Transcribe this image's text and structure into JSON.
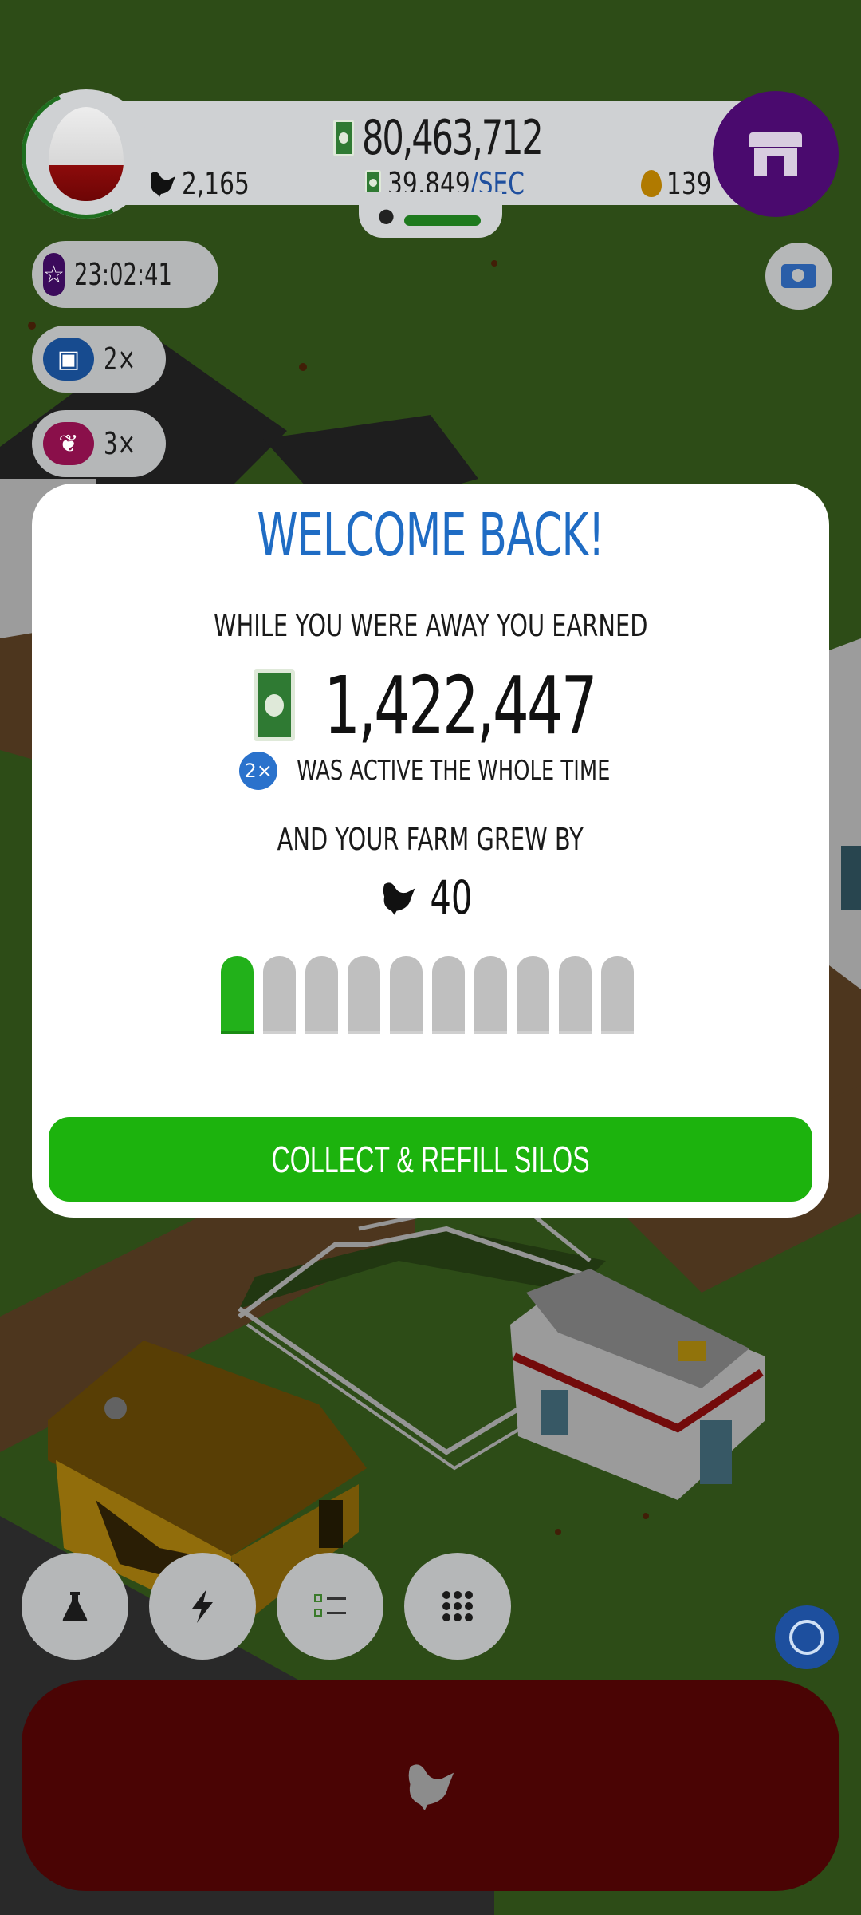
{
  "hud": {
    "cash": "80,463,712",
    "chickens": "2,165",
    "rate_value": "39,849",
    "rate_unit": "/SEC",
    "golden_eggs": "139",
    "egg_icon": "egg-icon",
    "shop_icon": "shop-icon"
  },
  "boosts": {
    "timer": "23:02:41",
    "video_multiplier": "2×",
    "boost_multiplier": "3×"
  },
  "modal": {
    "title": "WELCOME BACK!",
    "earned_label": "WHILE YOU WERE AWAY YOU EARNED",
    "earned_amount": "1,422,447",
    "boost_badge": "2×",
    "active_label": "WAS ACTIVE THE WHOLE TIME",
    "grew_label": "AND YOUR FARM GREW BY",
    "chickens_gained": "40",
    "silos": {
      "filled": 1,
      "total": 10
    },
    "collect_button": "COLLECT & REFILL SILOS"
  },
  "toolbar": {
    "icons": [
      "flask-icon",
      "lightning-icon",
      "checklist-icon",
      "grid-icon"
    ]
  },
  "colors": {
    "title_blue": "#1f6cc4",
    "collect_green": "#1cb30d",
    "silo_filled": "#22b11a",
    "silo_empty": "#bfbfbf",
    "shop_purple": "#4a0a6e",
    "hatch_red": "#4a0404"
  }
}
